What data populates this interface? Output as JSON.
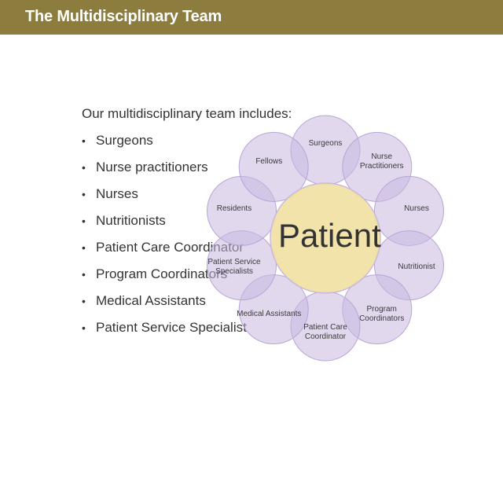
{
  "header": {
    "title": "The Multidisciplinary Team"
  },
  "intro": "Our multidisciplinary team includes:",
  "bullets": [
    "Surgeons",
    "Nurse practitioners",
    "Nurses",
    "Nutritionists",
    "Patient Care Coordinator",
    "Program Coordinators",
    "Medical Assistants",
    "Patient Service Specialist"
  ],
  "diagram": {
    "center": "Patient",
    "petals": [
      "Surgeons",
      "Nurse Practitioners",
      "Nurses",
      "Nutritionist",
      "Program Coordinators",
      "Patient Care Coordinator",
      "Medical Assistants",
      "Patient Service Specialists",
      "Residents",
      "Fellows"
    ]
  },
  "colors": {
    "header": "#8c7d3f",
    "center_fill": "#f0e0a0",
    "petal_fill": "#c9b8e0",
    "petal_stroke": "#b8a6d4"
  }
}
